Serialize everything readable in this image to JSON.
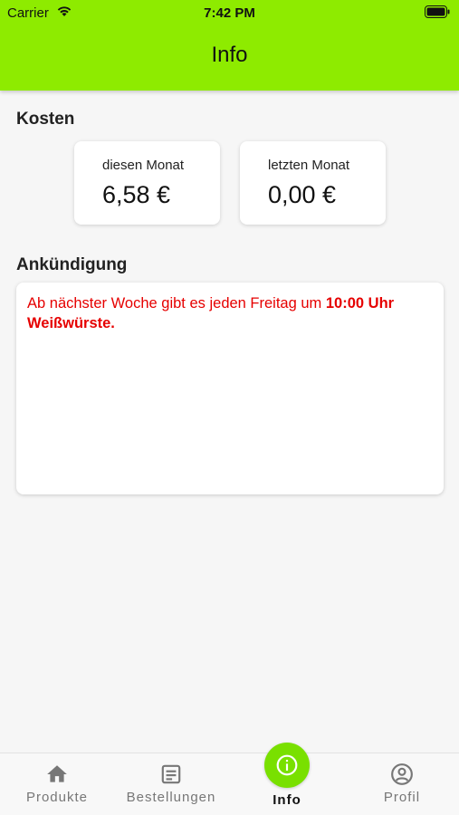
{
  "status_bar": {
    "carrier": "Carrier",
    "time": "7:42 PM"
  },
  "header": {
    "title": "Info",
    "color": "#8eeb00"
  },
  "kosten": {
    "title": "Kosten",
    "cards": [
      {
        "label": "diesen Monat",
        "value": "6,58 €"
      },
      {
        "label": "letzten Monat",
        "value": "0,00 €"
      }
    ]
  },
  "announcement": {
    "title": "Ankündigung",
    "text_regular": "Ab nächster Woche gibt es jeden Freitag um ",
    "text_bold": "10:00 Uhr Weißwürste.",
    "color": "#e60000"
  },
  "nav": {
    "items": [
      {
        "label": "Produkte",
        "icon": "home-icon"
      },
      {
        "label": "Bestellungen",
        "icon": "orders-icon"
      },
      {
        "label": "Info",
        "icon": "info-icon",
        "active": true
      },
      {
        "label": "Profil",
        "icon": "profile-icon"
      }
    ]
  }
}
